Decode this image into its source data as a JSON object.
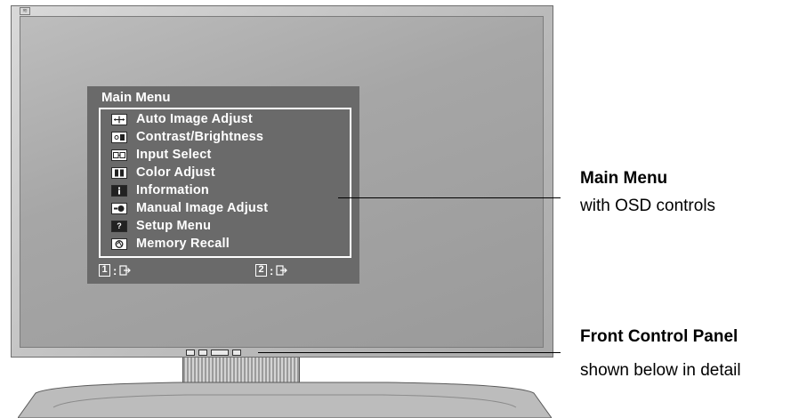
{
  "osd": {
    "title": "Main Menu",
    "items": [
      {
        "label": "Auto Image Adjust",
        "icon": "auto-adjust-icon"
      },
      {
        "label": "Contrast/Brightness",
        "icon": "contrast-brightness-icon"
      },
      {
        "label": "Input Select",
        "icon": "input-select-icon"
      },
      {
        "label": "Color Adjust",
        "icon": "color-adjust-icon"
      },
      {
        "label": "Information",
        "icon": "information-icon"
      },
      {
        "label": "Manual Image Adjust",
        "icon": "manual-adjust-icon"
      },
      {
        "label": "Setup Menu",
        "icon": "setup-menu-icon"
      },
      {
        "label": "Memory Recall",
        "icon": "memory-recall-icon"
      }
    ],
    "footer": {
      "key1": "1",
      "key2": "2",
      "separator": ":"
    }
  },
  "callouts": {
    "main_menu_title": "Main Menu",
    "main_menu_sub": "with OSD controls",
    "front_panel_title": "Front Control Panel",
    "front_panel_sub": "shown below in detail"
  }
}
